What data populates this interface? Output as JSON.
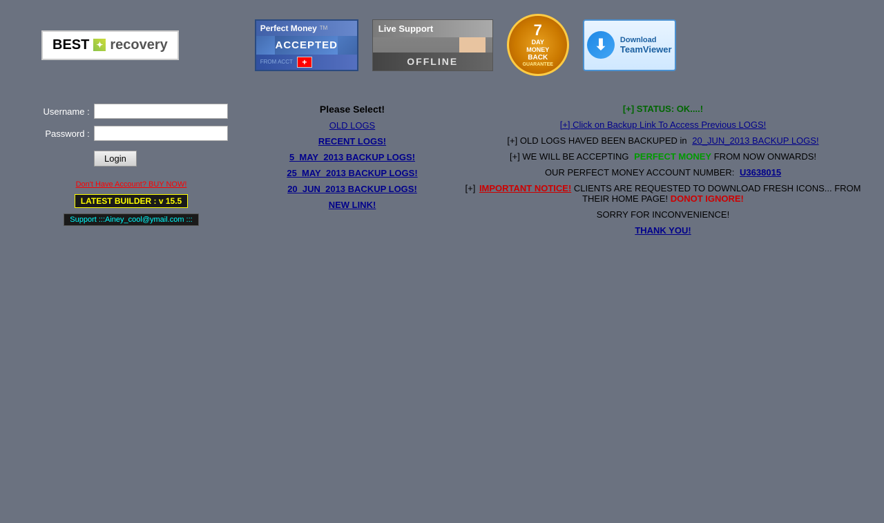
{
  "logo": {
    "text_best": "BEST",
    "text_icon": "✦",
    "text_recovery": "recovery"
  },
  "banners": {
    "perfect_money": {
      "top_text": "Perfect Money",
      "tm": "TM",
      "accepted": "ACCEPTED",
      "from_text": "FROM ACCT"
    },
    "live_support": {
      "title": "Live Support",
      "offline": "OFFLINE"
    },
    "money_back": {
      "days": "7",
      "day_text": "DAY",
      "money": "MONEY",
      "back": "BACK",
      "guarantee": "GUARANTEE"
    },
    "teamviewer": {
      "download": "Download",
      "name": "TeamViewer"
    }
  },
  "login": {
    "username_label": "Username :",
    "password_label": "Password :",
    "login_button": "Login"
  },
  "left_links": {
    "buy_now": "Don't Have Account? BUY NOW!",
    "latest_builder": "LATEST BUILDER : v 15.5",
    "support": "Support :::Ainey_cool@ymail.com :::"
  },
  "middle": {
    "please_select": "Please Select!",
    "old_logs": "OLD LOGS",
    "recent_logs": "RECENT LOGS!",
    "backup_5may": "5_MAY_2013 BACKUP LOGS!",
    "backup_25may": "25_MAY_2013 BACKUP LOGS!",
    "backup_20jun": "20_JUN_2013 BACKUP LOGS!",
    "new_link": "NEW LINK!"
  },
  "right": {
    "status": "[+] STATUS: OK....!",
    "backup_link": "[+] Click on Backup Link To Access Previous LOGS!",
    "old_logs_backed": "[+] OLD LOGS HAVED BEEN BACKUPED in",
    "backup_link_text": "20_JUN_2013 BACKUP LOGS!",
    "accepting_pm": "[+] WE WILL BE ACCEPTING",
    "perfect_money": "PERFECT MONEY",
    "from_now": " FROM  NOW ONWARDS!",
    "account_label": "OUR PERFECT MONEY ACCOUNT NUMBER:",
    "account_number": "U3638015",
    "important_prefix": "[+]",
    "important_notice": "IMPORTANT NOTICE!",
    "clients_text": " CLIENTS ARE REQUESTED TO DOWNLOAD FRESH ICONS... FROM THEIR HOME PAGE!",
    "donot_ignore": "  DONOT IGNORE!",
    "sorry": "SORRY FOR INCONVENIENCE!",
    "thank_you": "THANK YOU!"
  }
}
